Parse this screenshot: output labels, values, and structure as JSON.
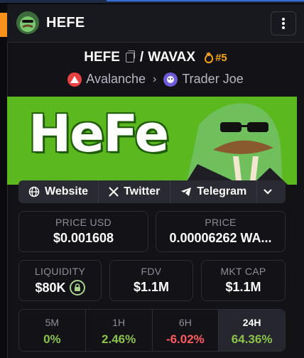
{
  "header": {
    "title": "HEFE"
  },
  "pair": {
    "base": "HEFE",
    "separator": "/",
    "quote": "WAVAX",
    "rank": "#5"
  },
  "chain": {
    "network": "Avalanche",
    "dex": "Trader Joe"
  },
  "banner": {
    "text": "HeFe"
  },
  "links": {
    "website": "Website",
    "twitter": "Twitter",
    "telegram": "Telegram"
  },
  "stats": {
    "price_usd": {
      "label": "PRICE USD",
      "value": "$0.001608"
    },
    "price": {
      "label": "PRICE",
      "value": "0.00006262 WA..."
    },
    "liquidity": {
      "label": "LIQUIDITY",
      "value": "$80K"
    },
    "fdv": {
      "label": "FDV",
      "value": "$1.1M"
    },
    "mkt_cap": {
      "label": "MKT CAP",
      "value": "$1.1M"
    }
  },
  "changes": [
    {
      "label": "5M",
      "value": "0%"
    },
    {
      "label": "1H",
      "value": "2.46%"
    },
    {
      "label": "6H",
      "value": "-6.02%"
    },
    {
      "label": "24H",
      "value": "64.36%"
    }
  ],
  "colors": {
    "accent_orange": "#f7931a",
    "rank": "#f7a21b",
    "positive": "#8bc34a",
    "negative": "#ff5a5f",
    "banner_green": "#5bb81f"
  }
}
